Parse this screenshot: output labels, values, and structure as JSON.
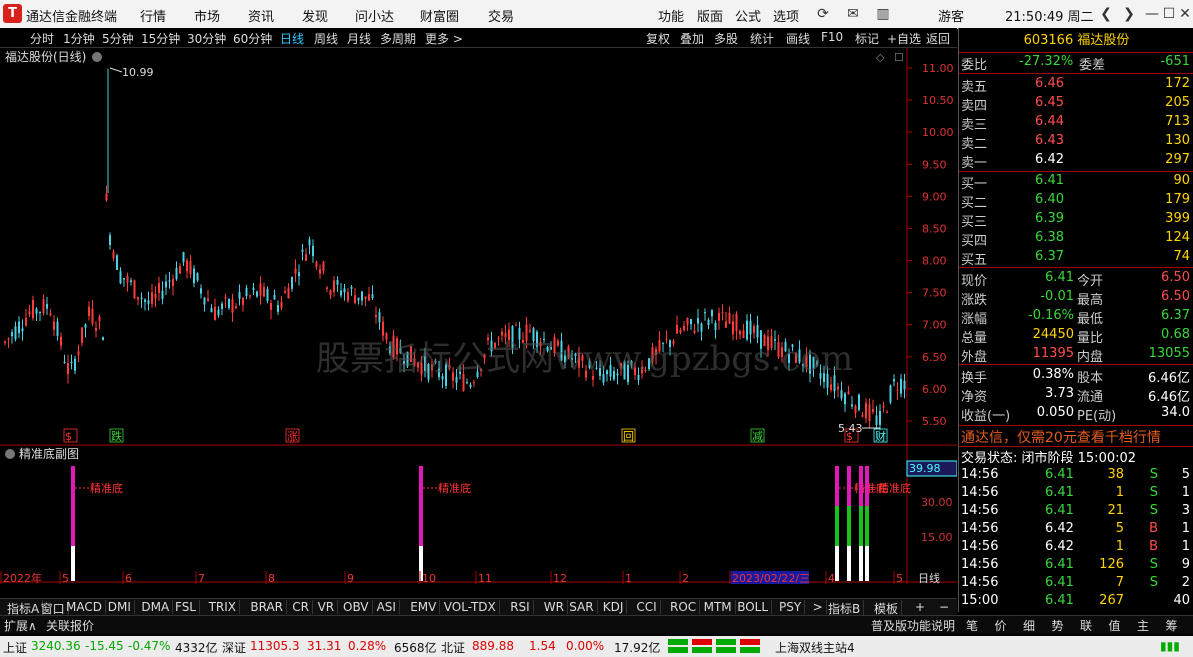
{
  "titlebar": {
    "app_title": "通达信金融终端",
    "menus": [
      "行情",
      "市场",
      "资讯",
      "发现",
      "问小达",
      "财富圈",
      "交易"
    ],
    "right_menus": [
      "功能",
      "版面",
      "公式",
      "选项"
    ],
    "user": "游客",
    "clock": "21:50:49 周二",
    "icons": [
      "refresh-icon",
      "mail-icon",
      "chart-icon"
    ]
  },
  "timeframes": [
    "分时",
    "1分钟",
    "5分钟",
    "15分钟",
    "30分钟",
    "60分钟",
    "日线",
    "周线",
    "月线",
    "多周期",
    "更多 >"
  ],
  "active_timeframe": "日线",
  "chart_tools": [
    "复权",
    "叠加",
    "多股",
    "统计",
    "画线",
    "F10",
    "标记",
    "+自选",
    "返回"
  ],
  "chart": {
    "title": "福达股份(日线)",
    "max_label": "10.99",
    "min_label": "5.43",
    "watermark": "股票指标公式网www.gpzbgs.com",
    "y_ticks": [
      "11.00",
      "10.50",
      "10.00",
      "9.50",
      "9.00",
      "8.50",
      "8.00",
      "7.50",
      "7.00",
      "6.50",
      "6.00",
      "5.50"
    ],
    "event_marks": [
      {
        "text": "$",
        "color": "#ff3333",
        "x": "70"
      },
      {
        "text": "跌",
        "color": "#39d839",
        "x": "116"
      },
      {
        "text": "涨",
        "color": "#ff3333",
        "x": "292"
      },
      {
        "text": "回",
        "color": "#ffd400",
        "x": "628"
      },
      {
        "text": "减",
        "color": "#39d839",
        "x": "757"
      },
      {
        "text": "$",
        "color": "#ff3333",
        "x": "851"
      },
      {
        "text": "财",
        "color": "#4ff",
        "x": "880"
      }
    ]
  },
  "sub_chart": {
    "title": "精准底副图",
    "value_box": "39.98",
    "y_ticks": [
      "30.00",
      "15.00"
    ],
    "signal_label": "精准底",
    "signals": [
      72,
      420,
      836,
      848,
      860,
      866
    ]
  },
  "x_axis": {
    "labels": [
      "2022年",
      "5",
      "6",
      "7",
      "8",
      "9",
      "10",
      "11",
      "12",
      "1",
      "2",
      "2023/02/22/三",
      "4",
      "5"
    ],
    "period_label": "日线"
  },
  "right_panel": {
    "code": "603166",
    "name": "福达股份",
    "weibi_label": "委比",
    "weibi": "-27.32%",
    "weicha_label": "委差",
    "weicha": "-651",
    "sells": [
      {
        "label": "卖五",
        "price": "6.46",
        "vol": "172"
      },
      {
        "label": "卖四",
        "price": "6.45",
        "vol": "205"
      },
      {
        "label": "卖三",
        "price": "6.44",
        "vol": "713"
      },
      {
        "label": "卖二",
        "price": "6.43",
        "vol": "130"
      },
      {
        "label": "卖一",
        "price": "6.42",
        "vol": "297"
      }
    ],
    "buys": [
      {
        "label": "买一",
        "price": "6.41",
        "vol": "90"
      },
      {
        "label": "买二",
        "price": "6.40",
        "vol": "179"
      },
      {
        "label": "买三",
        "price": "6.39",
        "vol": "399"
      },
      {
        "label": "买四",
        "price": "6.38",
        "vol": "124"
      },
      {
        "label": "买五",
        "price": "6.37",
        "vol": "74"
      }
    ],
    "stats": [
      {
        "l1": "现价",
        "v1": "6.41",
        "c1": "green",
        "l2": "今开",
        "v2": "6.50",
        "c2": "red"
      },
      {
        "l1": "涨跌",
        "v1": "-0.01",
        "c1": "green",
        "l2": "最高",
        "v2": "6.50",
        "c2": "red"
      },
      {
        "l1": "涨幅",
        "v1": "-0.16%",
        "c1": "green",
        "l2": "最低",
        "v2": "6.37",
        "c2": "green"
      },
      {
        "l1": "总量",
        "v1": "24450",
        "c1": "yellow",
        "l2": "量比",
        "v2": "0.68",
        "c2": "green"
      },
      {
        "l1": "外盘",
        "v1": "11395",
        "c1": "red",
        "l2": "内盘",
        "v2": "13055",
        "c2": "green"
      }
    ],
    "stats2": [
      {
        "l1": "换手",
        "v1": "0.38%",
        "l2": "股本",
        "v2": "6.46亿"
      },
      {
        "l1": "净资",
        "v1": "3.73",
        "l2": "流通",
        "v2": "6.46亿"
      },
      {
        "l1": "收益(一)",
        "v1": "0.050",
        "l2": "PE(动)",
        "v2": "34.0"
      }
    ],
    "ad": "通达信，仅需20元查看千档行情",
    "trade_status": "交易状态: 闭市阶段 15:00:02",
    "ticks": [
      {
        "t": "14:56",
        "p": "6.41",
        "pc": "green",
        "v": "38",
        "d": "S",
        "n": "5"
      },
      {
        "t": "14:56",
        "p": "6.41",
        "pc": "green",
        "v": "1",
        "d": "S",
        "n": "1"
      },
      {
        "t": "14:56",
        "p": "6.41",
        "pc": "green",
        "v": "21",
        "d": "S",
        "n": "3"
      },
      {
        "t": "14:56",
        "p": "6.42",
        "pc": "white",
        "v": "5",
        "d": "B",
        "n": "1"
      },
      {
        "t": "14:56",
        "p": "6.42",
        "pc": "white",
        "v": "1",
        "d": "B",
        "n": "1"
      },
      {
        "t": "14:56",
        "p": "6.41",
        "pc": "green",
        "v": "126",
        "d": "S",
        "n": "9"
      },
      {
        "t": "14:56",
        "p": "6.41",
        "pc": "green",
        "v": "7",
        "d": "S",
        "n": "2"
      },
      {
        "t": "15:00",
        "p": "6.41",
        "pc": "green",
        "v": "267",
        "d": "",
        "n": "40"
      }
    ],
    "bottom_tabs": [
      "笔",
      "价",
      "细",
      "势",
      "联",
      "值",
      "主",
      "筹"
    ]
  },
  "indicator_tabs": [
    "指标A",
    "窗口",
    "MACD",
    "DMI",
    "DMA",
    "FSL",
    "TRIX",
    "BRAR",
    "CR",
    "VR",
    "OBV",
    "ASI",
    "EMV",
    "VOL-TDX",
    "RSI",
    "WR",
    "SAR",
    "KDJ",
    "CCI",
    "ROC",
    "MTM",
    "BOLL",
    "PSY",
    ">"
  ],
  "indicator_right": [
    "指标B",
    "模板",
    "+",
    "−"
  ],
  "ext_bar": {
    "expand": "扩展∧",
    "related": "关联报价",
    "help": "普及版功能说明"
  },
  "status_bar": {
    "sh": {
      "label": "上证",
      "value": "3240.36",
      "chg": "-15.45",
      "pct": "-0.47%",
      "amt": "4332亿"
    },
    "sz": {
      "label": "深证",
      "value": "11305.3",
      "chg": "31.31",
      "pct": "0.28%",
      "amt": "6568亿"
    },
    "bz": {
      "label": "北证",
      "value": "889.88",
      "chg": "1.54",
      "pct": "0.00%",
      "amt": "17.92亿"
    },
    "server": "上海双线主站4"
  }
}
